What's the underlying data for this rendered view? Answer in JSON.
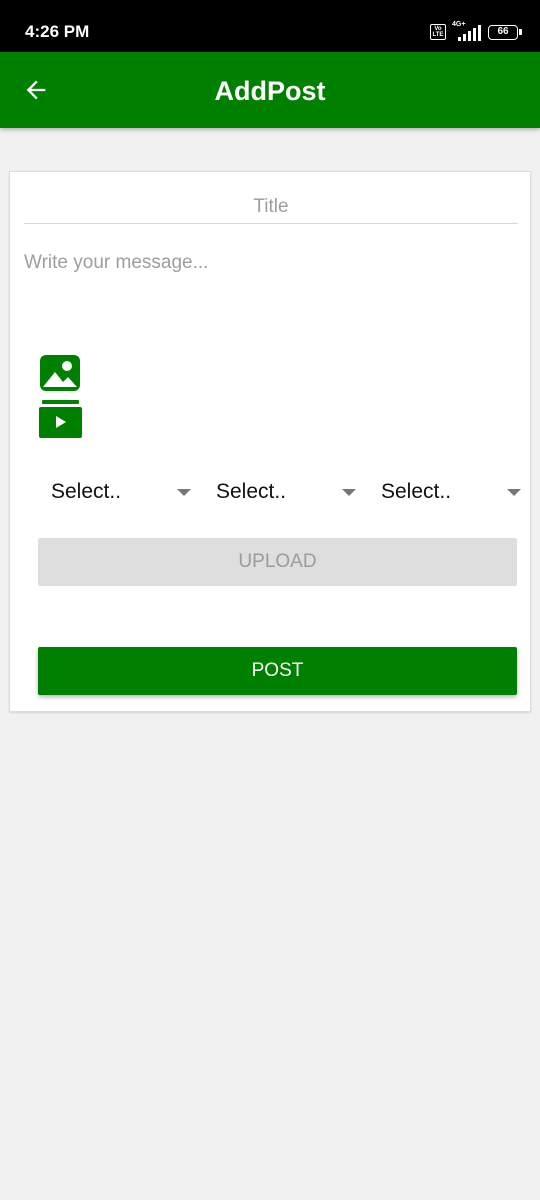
{
  "status_bar": {
    "time": "4:26 PM",
    "volte": "Vo LTE",
    "network": "4G+",
    "battery": "66"
  },
  "app_bar": {
    "title": "AddPost",
    "back_icon": "arrow-left-icon"
  },
  "form": {
    "title_placeholder": "Title",
    "title_value": "",
    "message_placeholder": "Write your message...",
    "message_value": "",
    "image_icon": "image-icon",
    "video_icon": "video-icon",
    "selects": [
      {
        "value": "Select.."
      },
      {
        "value": "Select.."
      },
      {
        "value": "Select.."
      }
    ],
    "upload_label": "UPLOAD",
    "post_label": "POST"
  },
  "colors": {
    "primary": "#008000",
    "background": "#f1f1f1",
    "disabled_button": "#dedede"
  }
}
